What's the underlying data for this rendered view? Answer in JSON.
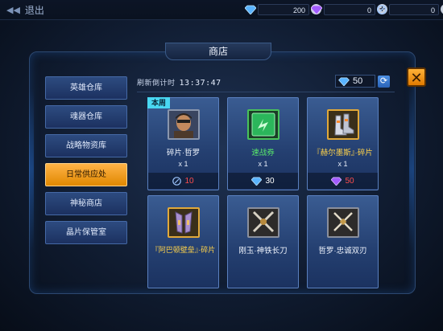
{
  "topbar": {
    "back_label": "退出",
    "resources": [
      {
        "icon": "blue-diamond-icon",
        "value": "200"
      },
      {
        "icon": "purple-diamond-icon",
        "value": "0"
      },
      {
        "icon": "gear-token-icon",
        "value": "0"
      }
    ]
  },
  "shop": {
    "title": "商店",
    "close_label": "✕",
    "countdown_label": "刷新倒计时",
    "countdown_time": "13:37:47",
    "currency_value": "50",
    "refresh_icon": "refresh-icon"
  },
  "sidebar": {
    "items": [
      {
        "label": "英雄仓库"
      },
      {
        "label": "魂器仓库"
      },
      {
        "label": "战略物资库"
      },
      {
        "label": "日常供应处"
      },
      {
        "label": "神秘商店"
      },
      {
        "label": "晶片保管室"
      }
    ],
    "active_index": 3
  },
  "cards": [
    {
      "badge": "本周",
      "name": "碎片·哲罗",
      "qty": "x 1",
      "price": "10",
      "price_currency": "gear-token-icon",
      "price_color": "#ff4d4d",
      "name_color": "default",
      "icon": "hero-portrait-icon"
    },
    {
      "badge": "",
      "name": "速战券",
      "qty": "x 1",
      "price": "30",
      "price_currency": "blue-diamond-icon",
      "price_color": "#ffffff",
      "name_color": "green",
      "icon": "ticket-icon"
    },
    {
      "badge": "",
      "name": "『赫尔墨斯』·碎片",
      "qty": "x 1",
      "price": "50",
      "price_currency": "purple-diamond-icon",
      "price_color": "#ff4d4d",
      "name_color": "gold",
      "icon": "boots-icon"
    },
    {
      "badge": "",
      "name": "『阿巴顿壁垒』·碎片",
      "qty": "",
      "price": "",
      "price_currency": "",
      "price_color": "#ffffff",
      "name_color": "gold",
      "icon": "armor-icon"
    },
    {
      "badge": "",
      "name": "刚玉·神铁长刀",
      "qty": "",
      "price": "",
      "price_currency": "",
      "price_color": "#ffffff",
      "name_color": "default",
      "icon": "crossed-swords-icon"
    },
    {
      "badge": "",
      "name": "哲罗·忠诚双刃",
      "qty": "",
      "price": "",
      "price_currency": "",
      "price_color": "#ffffff",
      "name_color": "default",
      "icon": "crossed-blades-icon"
    }
  ]
}
